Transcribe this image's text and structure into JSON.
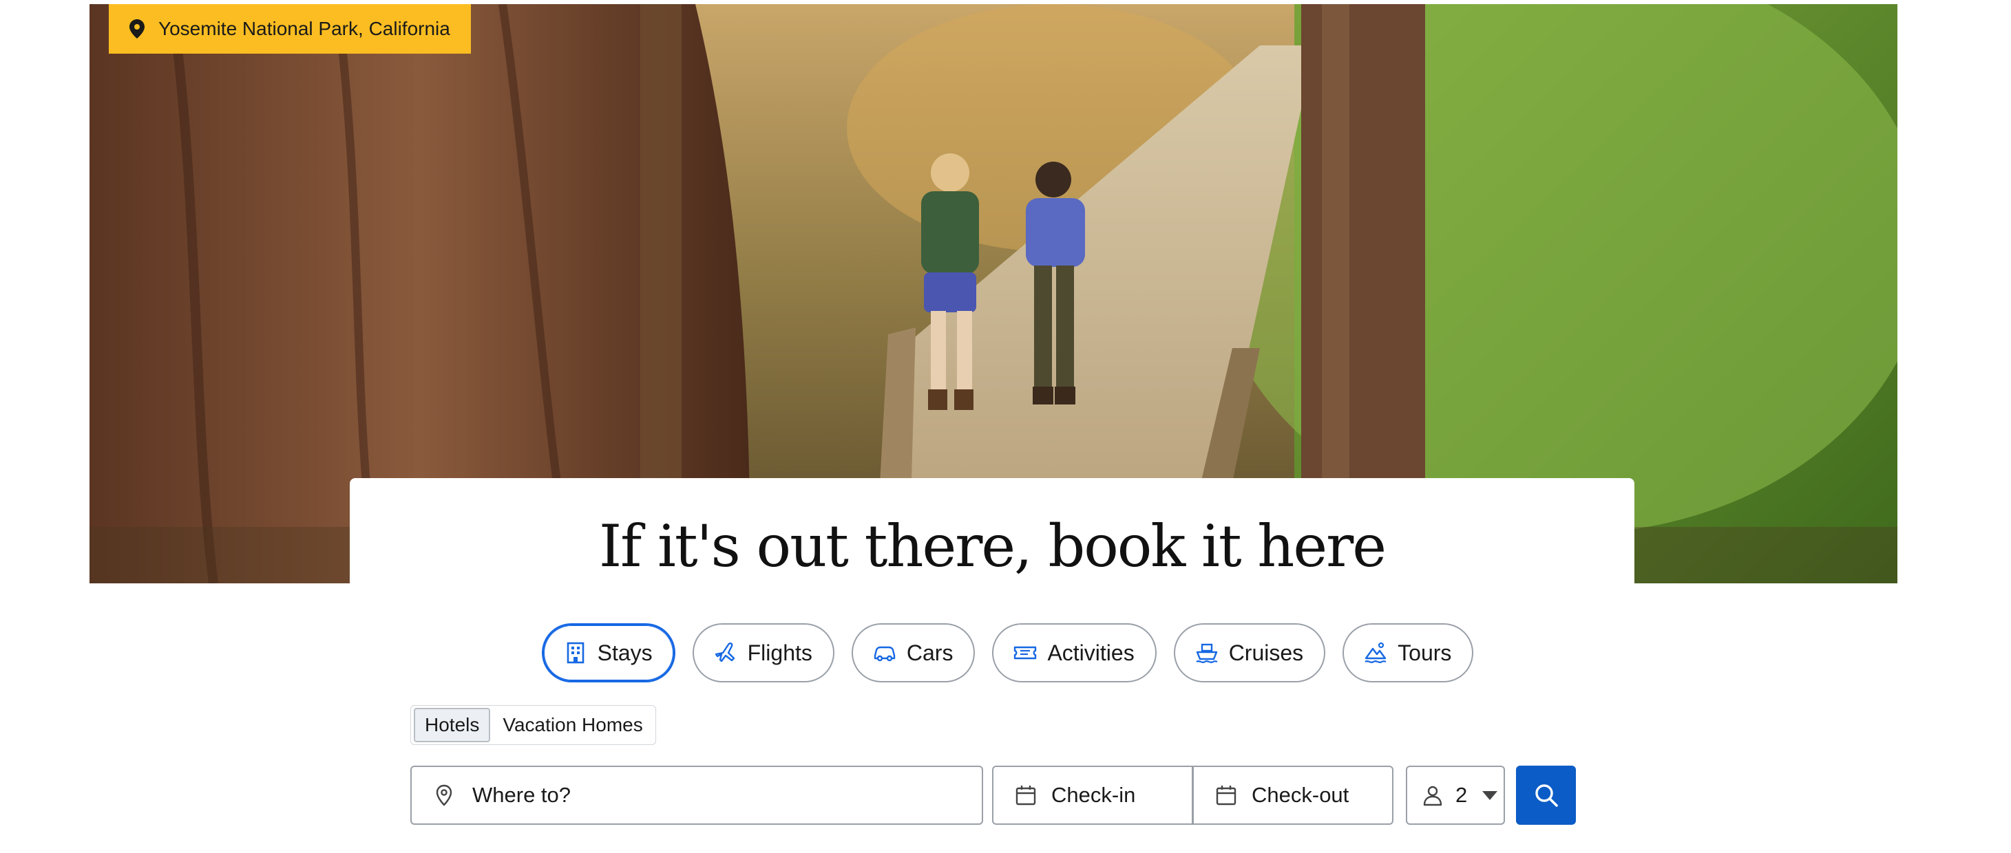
{
  "hero": {
    "location": "Yosemite National Park, California",
    "headline": "If it's out there, book it here"
  },
  "categories": [
    {
      "label": "Stays",
      "icon": "building-icon",
      "selected": true
    },
    {
      "label": "Flights",
      "icon": "plane-icon",
      "selected": false
    },
    {
      "label": "Cars",
      "icon": "car-icon",
      "selected": false
    },
    {
      "label": "Activities",
      "icon": "ticket-icon",
      "selected": false
    },
    {
      "label": "Cruises",
      "icon": "ship-icon",
      "selected": false
    },
    {
      "label": "Tours",
      "icon": "tour-icon",
      "selected": false
    }
  ],
  "subtabs": [
    {
      "label": "Hotels",
      "selected": true
    },
    {
      "label": "Vacation Homes",
      "selected": false
    }
  ],
  "search": {
    "destination_placeholder": "Where to?",
    "checkin_label": "Check-in",
    "checkout_label": "Check-out",
    "travelers": "2"
  },
  "colors": {
    "accent": "#1668e3",
    "search_button": "#0b5cc6",
    "location_tag": "#fbbd21"
  }
}
